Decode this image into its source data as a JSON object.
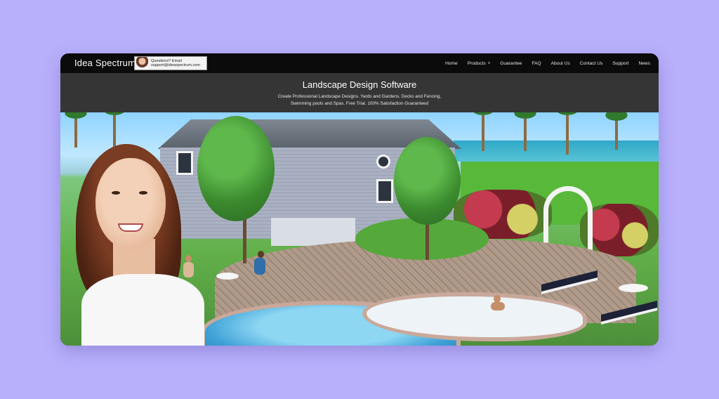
{
  "header": {
    "logo": "Idea Spectrum",
    "logo_mark": "®",
    "support_line1": "Questions? Email",
    "support_line2": "support@ideaspectrum.com"
  },
  "nav": {
    "items": [
      {
        "label": "Home"
      },
      {
        "label": "Products",
        "has_dropdown": true,
        "chevron": "˅"
      },
      {
        "label": "Guarantee"
      },
      {
        "label": "FAQ"
      },
      {
        "label": "About Us"
      },
      {
        "label": "Contact Us"
      },
      {
        "label": "Support"
      },
      {
        "label": "News"
      }
    ]
  },
  "hero": {
    "title": "Landscape Design Software",
    "description": "Create Professional Landscape Designs. Yards and Gardens. Decks and Fencing, Swimming pools and Spas. Free Trial. 100% Satisfaction Guaranteed"
  },
  "colors": {
    "page_background": "#b8b0fb",
    "topbar": "#0b0b0b",
    "header_band": "#353535"
  }
}
